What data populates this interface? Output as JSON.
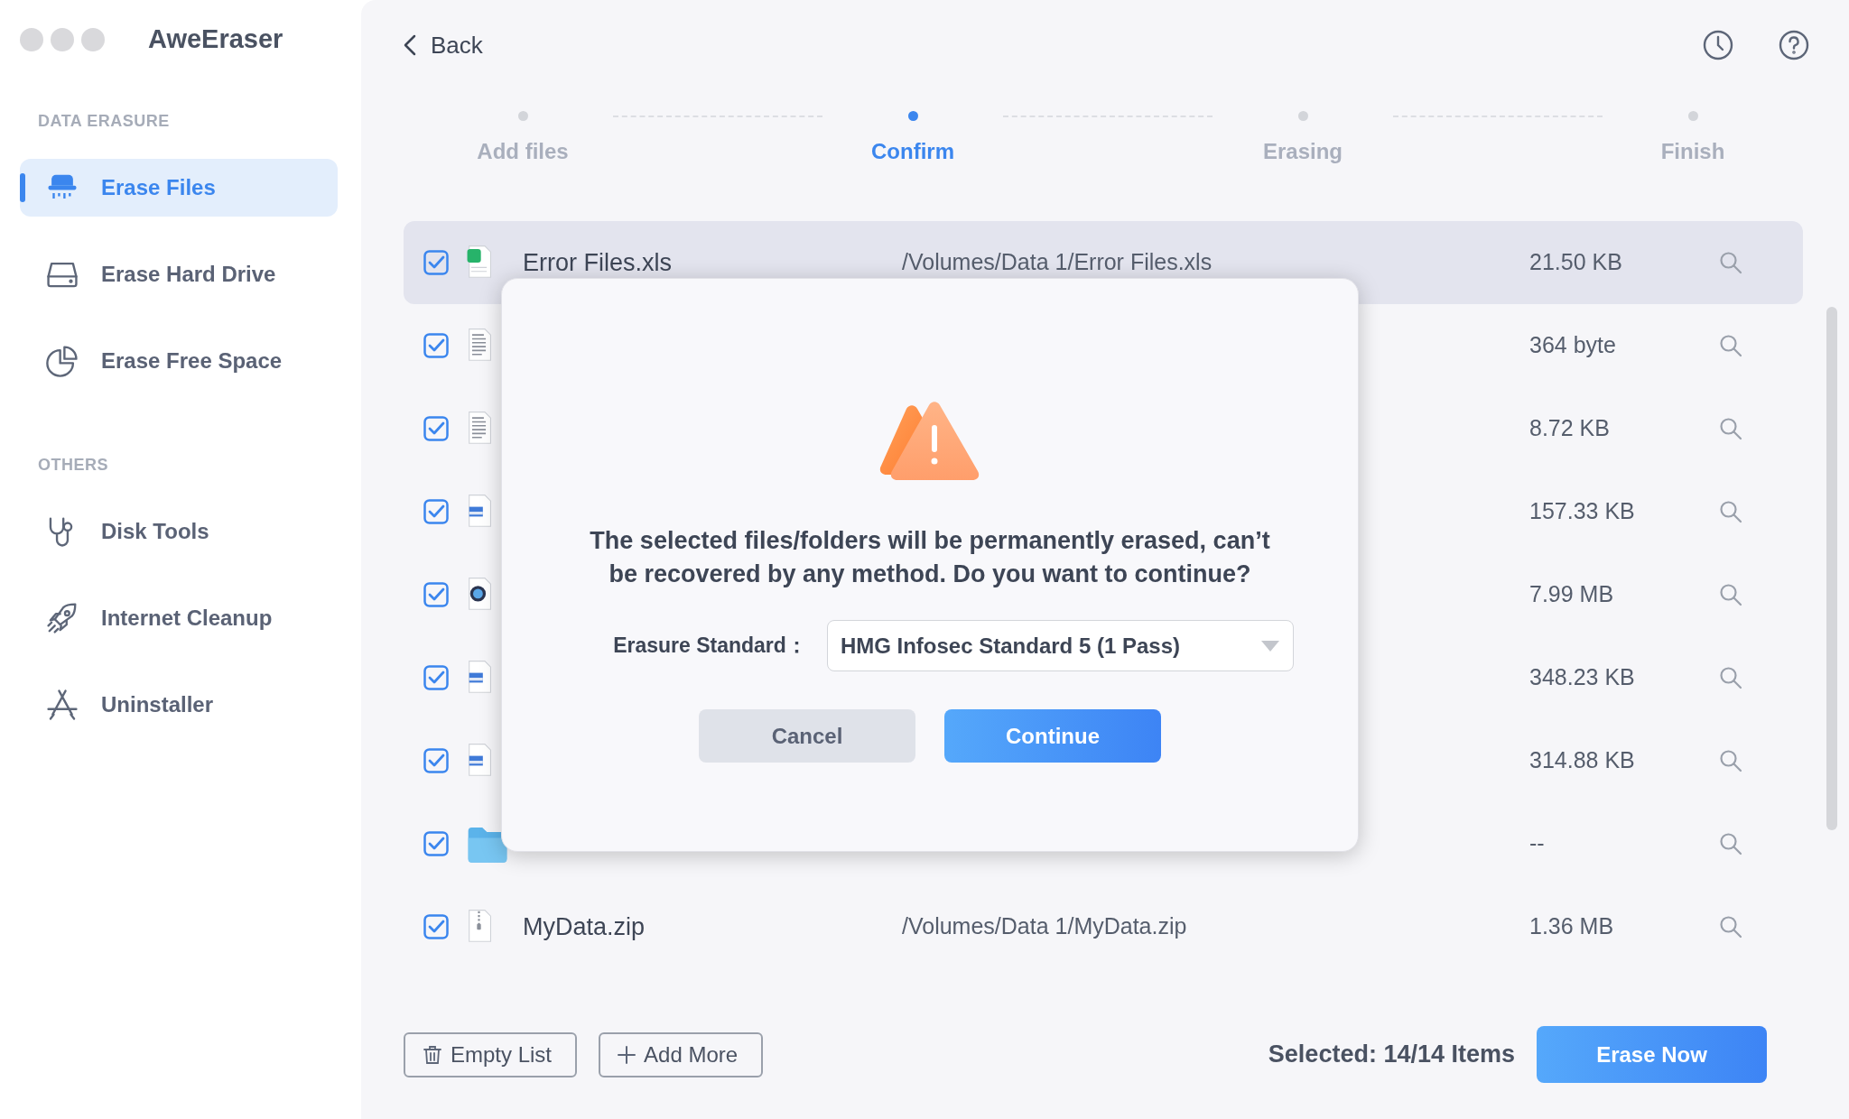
{
  "app": {
    "title": "AweEraser"
  },
  "sidebar": {
    "sections": [
      {
        "heading": "DATA ERASURE",
        "items": [
          {
            "label": "Erase Files",
            "kind": "shredder",
            "selected": true
          },
          {
            "label": "Erase Hard Drive",
            "kind": "drive",
            "selected": false
          },
          {
            "label": "Erase Free Space",
            "kind": "pie",
            "selected": false
          }
        ]
      },
      {
        "heading": "OTHERS",
        "items": [
          {
            "label": "Disk Tools",
            "kind": "stethoscope",
            "selected": false
          },
          {
            "label": "Internet Cleanup",
            "kind": "rocket",
            "selected": false
          },
          {
            "label": "Uninstaller",
            "kind": "apps",
            "selected": false
          }
        ]
      }
    ]
  },
  "back": "Back",
  "steps": [
    {
      "label": "Add files",
      "selected": false
    },
    {
      "label": "Confirm",
      "selected": true
    },
    {
      "label": "Erasing",
      "selected": false
    },
    {
      "label": "Finish",
      "selected": false
    }
  ],
  "files": [
    {
      "checked": true,
      "kind": "sheet",
      "selected": true,
      "name": "Error Files.xls",
      "path": "/Volumes/Data 1/Error Files.xls",
      "size": "21.50 KB"
    },
    {
      "checked": true,
      "kind": "doc",
      "selected": false,
      "size": "364 byte"
    },
    {
      "checked": true,
      "kind": "doc",
      "selected": false,
      "size": "8.72 KB"
    },
    {
      "checked": true,
      "kind": "image",
      "selected": false,
      "size": "157.33 KB"
    },
    {
      "checked": true,
      "kind": "video",
      "selected": false,
      "size": "7.99 MB"
    },
    {
      "checked": true,
      "kind": "image",
      "selected": false,
      "size": "348.23 KB"
    },
    {
      "checked": true,
      "kind": "image",
      "selected": false,
      "size": "314.88 KB"
    },
    {
      "checked": true,
      "kind": "folder",
      "selected": false,
      "size": "--"
    },
    {
      "checked": true,
      "kind": "zip",
      "selected": false,
      "name": "MyData.zip",
      "path": "/Volumes/Data 1/MyData.zip",
      "size": "1.36 MB"
    }
  ],
  "footer": {
    "empty_list": "Empty List",
    "add_more": "Add More",
    "selected_count": "Selected: 14/14 Items",
    "erase_now": "Erase Now"
  },
  "dialog": {
    "message": "The selected files/folders will be permanently erased, can’t be recovered by any method. Do you want to continue?",
    "standard_label": "Erasure Standard：",
    "standard_value": "HMG Infosec Standard 5 (1 Pass)",
    "cancel": "Cancel",
    "continue": "Continue"
  }
}
